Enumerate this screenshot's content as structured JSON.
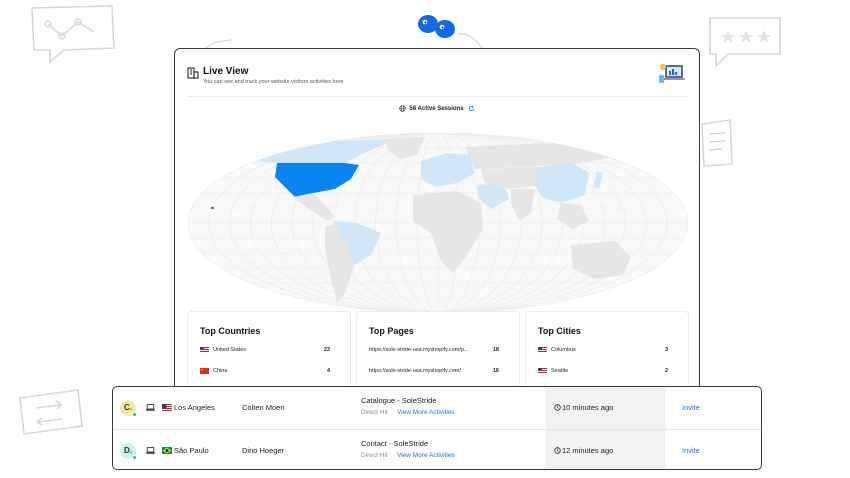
{
  "header": {
    "title": "Live View",
    "subtitle": "You can see and track your website visitors activities here"
  },
  "sessions": {
    "label": "58 Active Sessions"
  },
  "map": {
    "highlight_color": "#0a84f0",
    "light_color": "#cfe7f8",
    "base_color": "#e6e6e6"
  },
  "panels": {
    "countries": {
      "title": "Top Countries",
      "items": [
        {
          "flag": "us-flag",
          "label": "United States",
          "count": "23"
        },
        {
          "flag": "cn-flag",
          "label": "China",
          "count": "4"
        }
      ]
    },
    "pages": {
      "title": "Top Pages",
      "items": [
        {
          "label": "https://sole-stride-usa.myshopify.com/p...",
          "count": "18"
        },
        {
          "label": "https://sole-stride-usa.myshopify.com/",
          "count": "16"
        }
      ]
    },
    "cities": {
      "title": "Top Cities",
      "items": [
        {
          "flag": "us-flag",
          "label": "Columbus",
          "count": "3"
        },
        {
          "flag": "us-flag",
          "label": "Seattle",
          "count": "2"
        }
      ]
    }
  },
  "activity": [
    {
      "initial": "C.",
      "avatar_color": "#f7e9a3",
      "device": "laptop-icon",
      "flag": "us-flag",
      "city": "Los Angeles",
      "visitor": "Colten Moen",
      "page": "Catalogue - SoleStride",
      "source": "Direct Hit",
      "more_label": "View More Activities",
      "time": "10 minutes ago",
      "invite": "Invite"
    },
    {
      "initial": "D.",
      "avatar_color": "#c8f2ea",
      "device": "laptop-icon",
      "flag": "br-flag",
      "city": "São Paulo",
      "visitor": "Dino Hoeger",
      "page": "Contact - SoleStride",
      "source": "Direct Hit",
      "more_label": "View More Activities",
      "time": "12 minutes ago",
      "invite": "Invite"
    }
  ]
}
